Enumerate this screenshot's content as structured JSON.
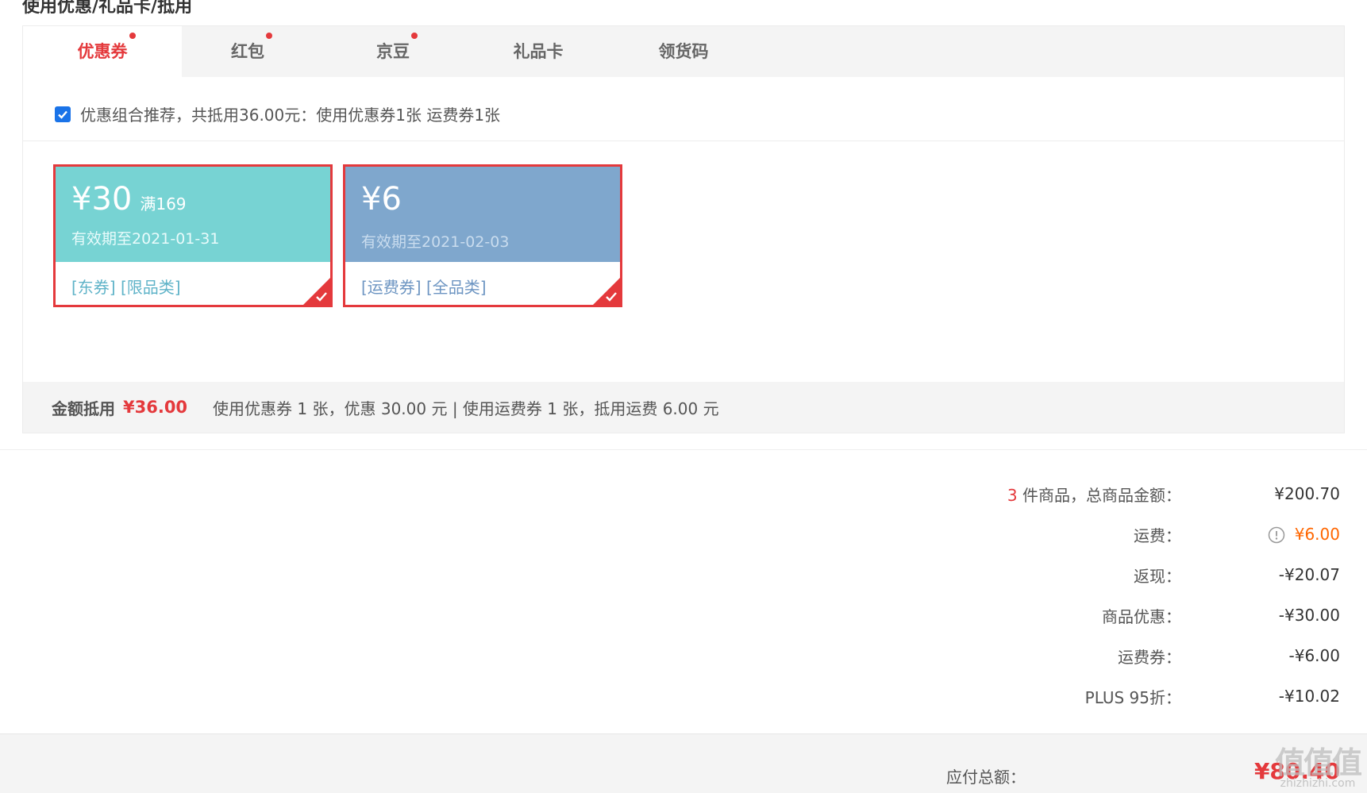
{
  "section": {
    "title": "使用优惠/礼品卡/抵用"
  },
  "tabs": [
    {
      "label": "优惠券",
      "dot": true,
      "active": true
    },
    {
      "label": "红包",
      "dot": true
    },
    {
      "label": "京豆",
      "dot": true
    },
    {
      "label": "礼品卡",
      "dot": false
    },
    {
      "label": "领货码",
      "dot": false
    }
  ],
  "recommend": {
    "text": "优惠组合推荐，共抵用36.00元：使用优惠券1张 运费券1张",
    "checked": true
  },
  "coupons": [
    {
      "amount": "¥30",
      "condition": "满169",
      "expiry": "有效期至2021-01-31",
      "tags": "[东券]  [限品类]",
      "color": "#77d3d3",
      "tag_color": "#5fb3c8",
      "selected": true
    },
    {
      "amount": "¥6",
      "condition": "",
      "expiry": "有效期至2021-02-03",
      "tags": "[运费券]  [全品类]",
      "color": "#7fa7cd",
      "tag_color": "#6d95c2",
      "selected": true
    }
  ],
  "summary": {
    "label": "金额抵用",
    "amount": "¥36.00",
    "detail": "使用优惠券 1 张，优惠 30.00 元  | 使用运费券 1 张，抵用运费 6.00 元"
  },
  "prices": {
    "goods_count": "3",
    "goods_label": " 件商品，总商品金额：",
    "goods_value": "¥200.70",
    "shipping_label": "运费：",
    "shipping_value": "¥6.00",
    "cashback_label": "返现：",
    "cashback_value": "-¥20.07",
    "discount_label": "商品优惠：",
    "discount_value": "-¥30.00",
    "shipcoupon_label": "运费券：",
    "shipcoupon_value": "-¥6.00",
    "plus_label": "PLUS 95折：",
    "plus_value": "-¥10.02"
  },
  "footer": {
    "total_label": "应付总额：",
    "total_value": "¥80.40"
  },
  "watermark": {
    "logo": "值值值",
    "text": "zhizhizhi.com"
  },
  "colors": {
    "accent": "#e4393c",
    "checkbox": "#1a73e8",
    "orange": "#ff6600"
  }
}
